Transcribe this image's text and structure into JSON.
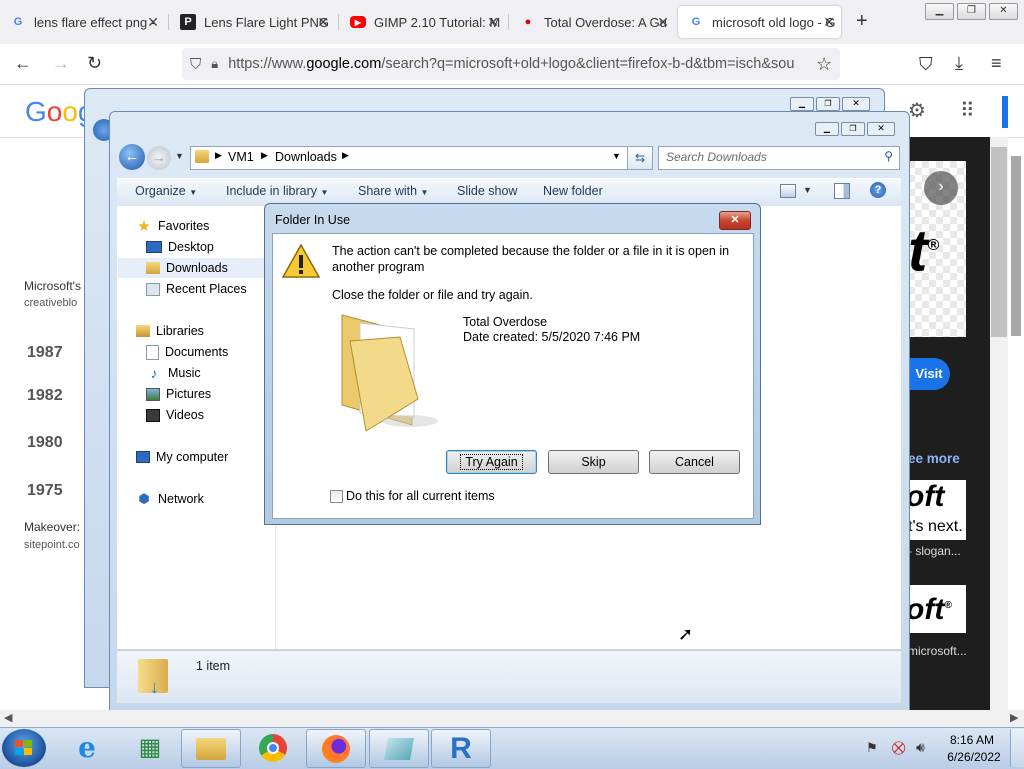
{
  "browser": {
    "tabs": [
      {
        "title": "lens flare effect png - ",
        "favicon": "G"
      },
      {
        "title": "Lens Flare Light PNG ",
        "favicon": "P"
      },
      {
        "title": "GIMP 2.10 Tutorial: M",
        "favicon": "yt"
      },
      {
        "title": "Total Overdose: A Gu",
        "favicon": "wiki"
      },
      {
        "title": "microsoft old logo - G",
        "favicon": "G",
        "active": true
      }
    ],
    "new_tab": "+",
    "url": "https://www.google.com/search?q=microsoft+old+logo&client=firefox-b-d&tbm=isch&sou",
    "url_prefix": "https://www.",
    "url_host": "google.com",
    "url_rest": "/search?q=microsoft+old+logo&client=firefox-b-d&tbm=isch&sou"
  },
  "google": {
    "logo": "Goog",
    "result1_title": "Microsoft's",
    "result1_source": "creativeblo",
    "years": [
      "1987",
      "1982",
      "1980",
      "1975"
    ],
    "result2_title": "Makeover:",
    "result2_source": "sitepoint.co",
    "visit": "Visit",
    "see_more": "ee more",
    "side_text1": "t's next.",
    "side_text2": "- slogan...",
    "side_text3": "microsoft..."
  },
  "explorer": {
    "path": [
      "VM1",
      "Downloads"
    ],
    "search_placeholder": "Search Downloads",
    "commands": [
      "Organize",
      "Include in library",
      "Share with",
      "Slide show",
      "New folder"
    ],
    "nav": {
      "favorites": "Favorites",
      "desktop": "Desktop",
      "downloads": "Downloads",
      "recent": "Recent Places",
      "libraries": "Libraries",
      "documents": "Documents",
      "music": "Music",
      "pictures": "Pictures",
      "videos": "Videos",
      "computer": "My computer",
      "network": "Network"
    },
    "status": "1 item"
  },
  "dialog": {
    "title": "Folder In Use",
    "message": "The action can't be completed because the folder or a file in it is open in another program",
    "instruction": "Close the folder or file and try again.",
    "item_name": "Total Overdose",
    "item_date": "Date created: 5/5/2020 7:46 PM",
    "try_again": "Try Again",
    "skip": "Skip",
    "cancel": "Cancel",
    "checkbox_label": "Do this for all current items"
  },
  "taskbar": {
    "time": "8:16 AM",
    "date": "6/26/2022"
  }
}
